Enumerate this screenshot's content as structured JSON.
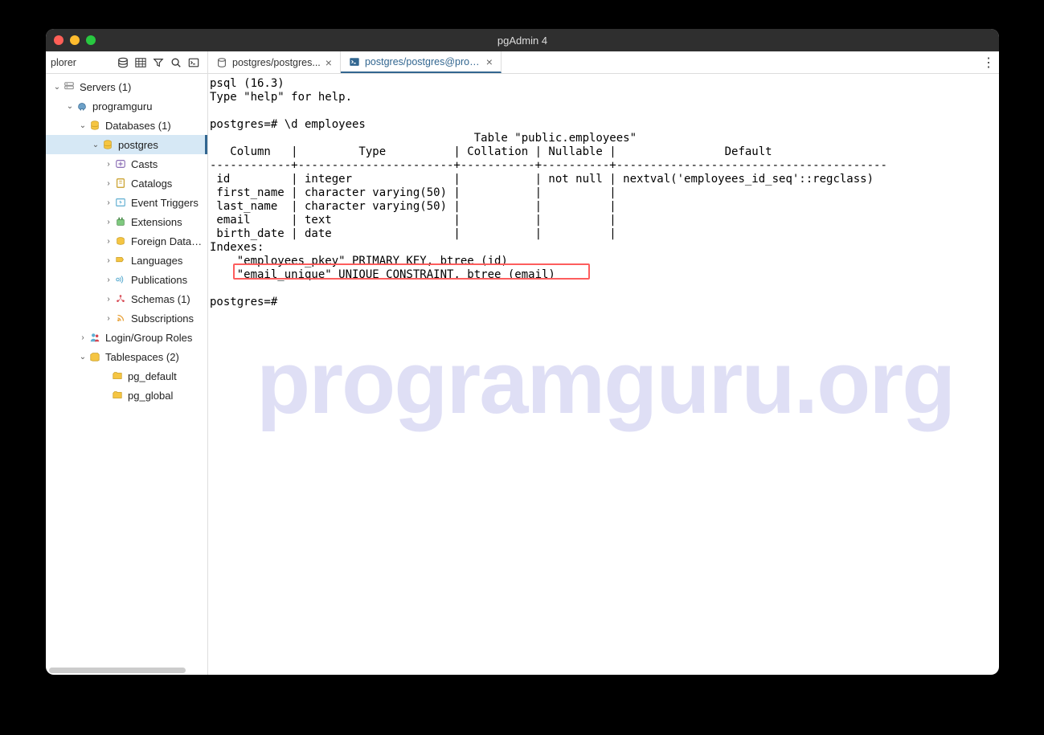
{
  "window": {
    "title": "pgAdmin 4"
  },
  "sidebar_header": {
    "label": "plorer"
  },
  "tabs": [
    {
      "label": "postgres/postgres...",
      "active": false
    },
    {
      "label": "postgres/postgres@programguru",
      "active": true
    }
  ],
  "tree": {
    "servers": "Servers (1)",
    "server_group": "programguru",
    "databases": "Databases (1)",
    "database": "postgres",
    "items": [
      "Casts",
      "Catalogs",
      "Event Triggers",
      "Extensions",
      "Foreign Data Wr",
      "Languages",
      "Publications",
      "Schemas (1)",
      "Subscriptions"
    ],
    "login_roles": "Login/Group Roles",
    "tablespaces": "Tablespaces (2)",
    "ts_items": [
      "pg_default",
      "pg_global"
    ]
  },
  "terminal": {
    "lines": [
      "psql (16.3)",
      "Type \"help\" for help.",
      "",
      "postgres=# \\d employees",
      "                                       Table \"public.employees\"",
      "   Column   |         Type          | Collation | Nullable |                Default",
      "------------+-----------------------+-----------+----------+----------------------------------------",
      " id         | integer               |           | not null | nextval('employees_id_seq'::regclass)",
      " first_name | character varying(50) |           |          |",
      " last_name  | character varying(50) |           |          |",
      " email      | text                  |           |          |",
      " birth_date | date                  |           |          |",
      "Indexes:",
      "    \"employees_pkey\" PRIMARY KEY, btree (id)",
      "    \"email_unique\" UNIQUE CONSTRAINT, btree (email)",
      "",
      "postgres=#"
    ]
  },
  "watermark": "programguru.org"
}
